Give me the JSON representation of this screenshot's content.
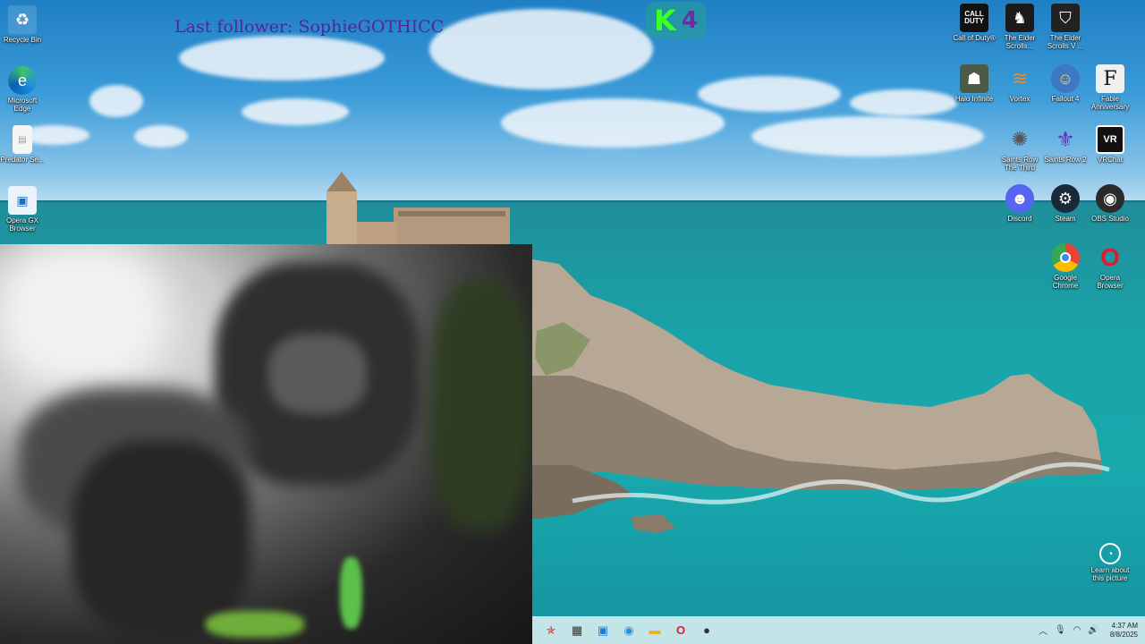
{
  "overlay": {
    "last_follower": "Last follower: SophieGOTHICC",
    "badge_letter": "K",
    "badge_number": "4"
  },
  "desktop_left": [
    {
      "name": "recycle-bin",
      "label": "Recycle Bin",
      "icon": "recycle-bin-icon"
    },
    {
      "name": "microsoft-edge",
      "label": "Microsoft Edge",
      "icon": "edge-icon"
    },
    {
      "name": "predator-se",
      "label": "Predator Se...",
      "icon": "file-icon"
    },
    {
      "name": "opera-gx",
      "label": "Opera GX Browser",
      "icon": "opera-gx-icon"
    }
  ],
  "desktop_right": [
    {
      "name": "call-of-duty",
      "label": "Call of Duty®",
      "icon": "cod-icon"
    },
    {
      "name": "elder-scrolls-online",
      "label": "The Elder Scrolls...",
      "icon": "elder-scrolls-icon"
    },
    {
      "name": "elder-scrolls-v",
      "label": "The Elder Scrolls V ...",
      "icon": "skyrim-icon"
    },
    {
      "name": "halo-infinite",
      "label": "Halo Infinite",
      "icon": "halo-icon"
    },
    {
      "name": "vortex",
      "label": "Vortex",
      "icon": "vortex-icon"
    },
    {
      "name": "fallout-4",
      "label": "Fallout 4",
      "icon": "fallout-icon"
    },
    {
      "name": "fable-anniversary",
      "label": "Fable Anniversary",
      "icon": "fable-icon"
    },
    {
      "name": "saints-row-third",
      "label": "Saints Row The Third",
      "icon": "saints-row-3-icon"
    },
    {
      "name": "saints-row-2",
      "label": "Saints Row 2",
      "icon": "saints-row-2-icon"
    },
    {
      "name": "vrchat",
      "label": "VRChat",
      "icon": "vrchat-icon"
    },
    {
      "name": "discord",
      "label": "Discord",
      "icon": "discord-icon"
    },
    {
      "name": "steam",
      "label": "Steam",
      "icon": "steam-icon"
    },
    {
      "name": "obs-studio",
      "label": "OBS Studio",
      "icon": "obs-icon"
    },
    {
      "name": "google-chrome",
      "label": "Google Chrome",
      "icon": "chrome-icon"
    },
    {
      "name": "opera-browser",
      "label": "Opera Browser",
      "icon": "opera-icon"
    },
    {
      "name": "learn-picture",
      "label": "Learn about this picture",
      "icon": "camera-icon"
    }
  ],
  "taskbar": {
    "apps": [
      "pinned-app-icon",
      "task-view-icon",
      "widgets-icon",
      "edge-icon",
      "file-explorer-icon",
      "opera-icon",
      "game-icon"
    ],
    "time": "4:37 AM",
    "date": "8/8/2025"
  },
  "colors": {
    "follower_text": "#5b1fa1",
    "badge_k": "#3cff2a",
    "badge_num": "#6a2fa3",
    "taskbar_bg": "#d2ebee"
  }
}
